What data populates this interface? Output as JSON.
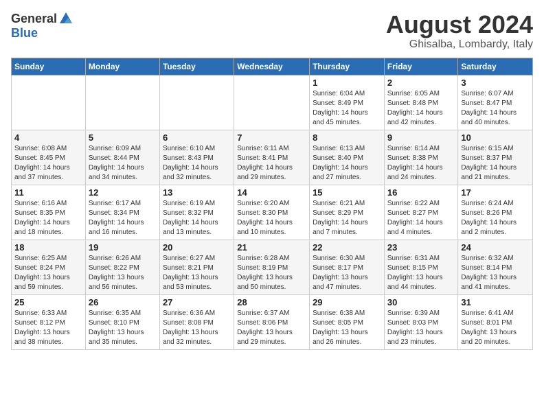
{
  "logo": {
    "general": "General",
    "blue": "Blue"
  },
  "title": {
    "month": "August 2024",
    "location": "Ghisalba, Lombardy, Italy"
  },
  "headers": [
    "Sunday",
    "Monday",
    "Tuesday",
    "Wednesday",
    "Thursday",
    "Friday",
    "Saturday"
  ],
  "weeks": [
    [
      {
        "day": "",
        "info": ""
      },
      {
        "day": "",
        "info": ""
      },
      {
        "day": "",
        "info": ""
      },
      {
        "day": "",
        "info": ""
      },
      {
        "day": "1",
        "info": "Sunrise: 6:04 AM\nSunset: 8:49 PM\nDaylight: 14 hours\nand 45 minutes."
      },
      {
        "day": "2",
        "info": "Sunrise: 6:05 AM\nSunset: 8:48 PM\nDaylight: 14 hours\nand 42 minutes."
      },
      {
        "day": "3",
        "info": "Sunrise: 6:07 AM\nSunset: 8:47 PM\nDaylight: 14 hours\nand 40 minutes."
      }
    ],
    [
      {
        "day": "4",
        "info": "Sunrise: 6:08 AM\nSunset: 8:45 PM\nDaylight: 14 hours\nand 37 minutes."
      },
      {
        "day": "5",
        "info": "Sunrise: 6:09 AM\nSunset: 8:44 PM\nDaylight: 14 hours\nand 34 minutes."
      },
      {
        "day": "6",
        "info": "Sunrise: 6:10 AM\nSunset: 8:43 PM\nDaylight: 14 hours\nand 32 minutes."
      },
      {
        "day": "7",
        "info": "Sunrise: 6:11 AM\nSunset: 8:41 PM\nDaylight: 14 hours\nand 29 minutes."
      },
      {
        "day": "8",
        "info": "Sunrise: 6:13 AM\nSunset: 8:40 PM\nDaylight: 14 hours\nand 27 minutes."
      },
      {
        "day": "9",
        "info": "Sunrise: 6:14 AM\nSunset: 8:38 PM\nDaylight: 14 hours\nand 24 minutes."
      },
      {
        "day": "10",
        "info": "Sunrise: 6:15 AM\nSunset: 8:37 PM\nDaylight: 14 hours\nand 21 minutes."
      }
    ],
    [
      {
        "day": "11",
        "info": "Sunrise: 6:16 AM\nSunset: 8:35 PM\nDaylight: 14 hours\nand 18 minutes."
      },
      {
        "day": "12",
        "info": "Sunrise: 6:17 AM\nSunset: 8:34 PM\nDaylight: 14 hours\nand 16 minutes."
      },
      {
        "day": "13",
        "info": "Sunrise: 6:19 AM\nSunset: 8:32 PM\nDaylight: 14 hours\nand 13 minutes."
      },
      {
        "day": "14",
        "info": "Sunrise: 6:20 AM\nSunset: 8:30 PM\nDaylight: 14 hours\nand 10 minutes."
      },
      {
        "day": "15",
        "info": "Sunrise: 6:21 AM\nSunset: 8:29 PM\nDaylight: 14 hours\nand 7 minutes."
      },
      {
        "day": "16",
        "info": "Sunrise: 6:22 AM\nSunset: 8:27 PM\nDaylight: 14 hours\nand 4 minutes."
      },
      {
        "day": "17",
        "info": "Sunrise: 6:24 AM\nSunset: 8:26 PM\nDaylight: 14 hours\nand 2 minutes."
      }
    ],
    [
      {
        "day": "18",
        "info": "Sunrise: 6:25 AM\nSunset: 8:24 PM\nDaylight: 13 hours\nand 59 minutes."
      },
      {
        "day": "19",
        "info": "Sunrise: 6:26 AM\nSunset: 8:22 PM\nDaylight: 13 hours\nand 56 minutes."
      },
      {
        "day": "20",
        "info": "Sunrise: 6:27 AM\nSunset: 8:21 PM\nDaylight: 13 hours\nand 53 minutes."
      },
      {
        "day": "21",
        "info": "Sunrise: 6:28 AM\nSunset: 8:19 PM\nDaylight: 13 hours\nand 50 minutes."
      },
      {
        "day": "22",
        "info": "Sunrise: 6:30 AM\nSunset: 8:17 PM\nDaylight: 13 hours\nand 47 minutes."
      },
      {
        "day": "23",
        "info": "Sunrise: 6:31 AM\nSunset: 8:15 PM\nDaylight: 13 hours\nand 44 minutes."
      },
      {
        "day": "24",
        "info": "Sunrise: 6:32 AM\nSunset: 8:14 PM\nDaylight: 13 hours\nand 41 minutes."
      }
    ],
    [
      {
        "day": "25",
        "info": "Sunrise: 6:33 AM\nSunset: 8:12 PM\nDaylight: 13 hours\nand 38 minutes."
      },
      {
        "day": "26",
        "info": "Sunrise: 6:35 AM\nSunset: 8:10 PM\nDaylight: 13 hours\nand 35 minutes."
      },
      {
        "day": "27",
        "info": "Sunrise: 6:36 AM\nSunset: 8:08 PM\nDaylight: 13 hours\nand 32 minutes."
      },
      {
        "day": "28",
        "info": "Sunrise: 6:37 AM\nSunset: 8:06 PM\nDaylight: 13 hours\nand 29 minutes."
      },
      {
        "day": "29",
        "info": "Sunrise: 6:38 AM\nSunset: 8:05 PM\nDaylight: 13 hours\nand 26 minutes."
      },
      {
        "day": "30",
        "info": "Sunrise: 6:39 AM\nSunset: 8:03 PM\nDaylight: 13 hours\nand 23 minutes."
      },
      {
        "day": "31",
        "info": "Sunrise: 6:41 AM\nSunset: 8:01 PM\nDaylight: 13 hours\nand 20 minutes."
      }
    ]
  ]
}
